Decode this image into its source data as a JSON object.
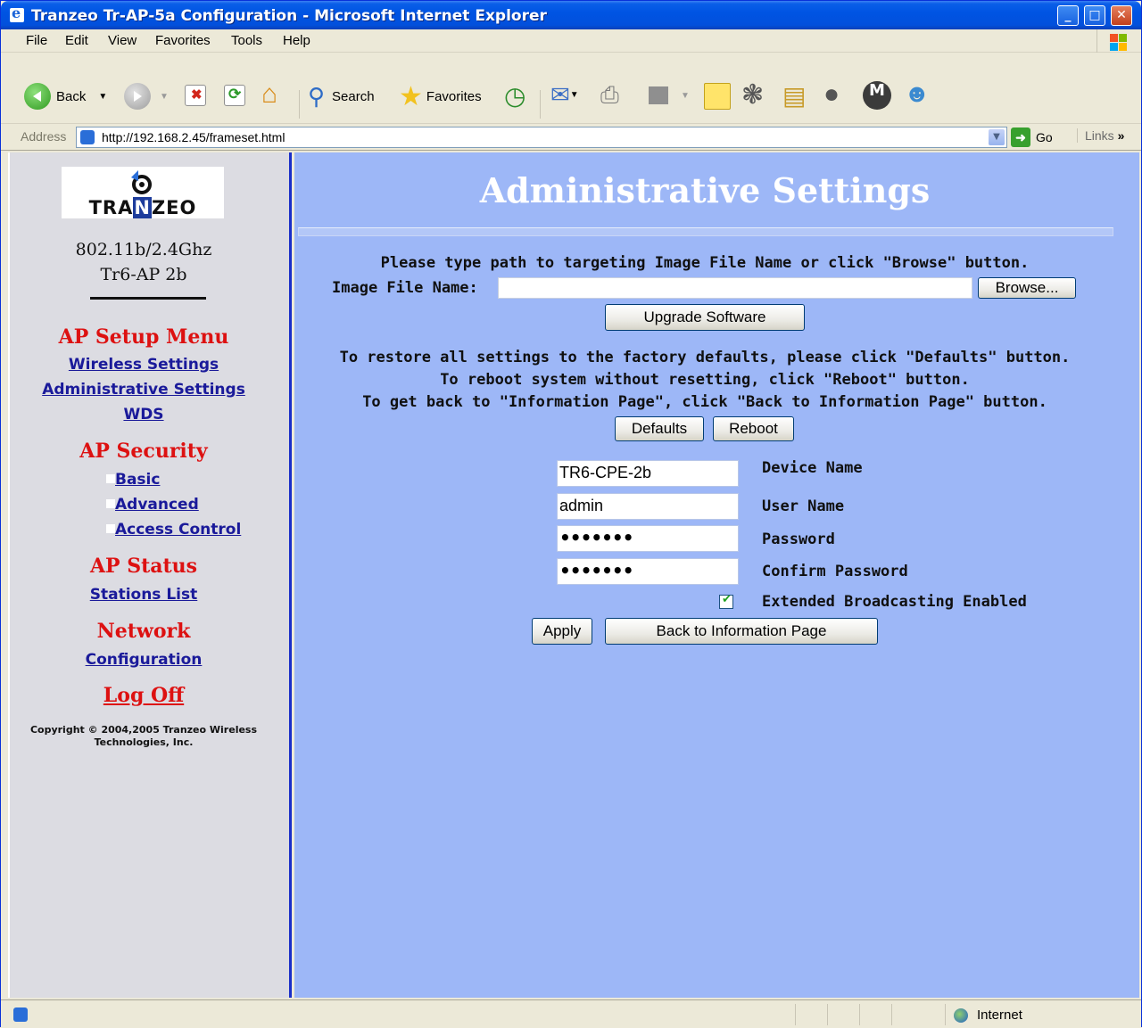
{
  "window": {
    "title": "Tranzeo Tr-AP-5a Configuration - Microsoft Internet Explorer"
  },
  "menubar": [
    "File",
    "Edit",
    "View",
    "Favorites",
    "Tools",
    "Help"
  ],
  "toolbar": {
    "back": "Back",
    "search": "Search",
    "favorites": "Favorites"
  },
  "addressbar": {
    "label": "Address",
    "url": "http://192.168.2.45/frameset.html",
    "go": "Go",
    "links": "Links"
  },
  "sidebar": {
    "logo_text_a": "TRA",
    "logo_text_n": "N",
    "logo_text_b": "ZEO",
    "model_line1": "802.11b/2.4Ghz",
    "model_line2": "Tr6-AP 2b",
    "sections": [
      {
        "heading": "AP Setup Menu",
        "links": [
          "Wireless Settings",
          "Administrative Settings",
          "WDS"
        ]
      },
      {
        "heading": "AP Security",
        "links": [
          "Basic",
          "Advanced",
          "Access Control"
        ]
      },
      {
        "heading": "AP Status",
        "links": [
          "Stations List"
        ]
      },
      {
        "heading": "Network",
        "links": [
          "Configuration"
        ]
      }
    ],
    "logoff": "Log Off",
    "copyright_line1": "Copyright © 2004,2005 Tranzeo Wireless",
    "copyright_line2": "Technologies, Inc."
  },
  "main": {
    "title": "Administrative Settings",
    "upgrade_instruction": "Please type path to targeting Image File Name or click \"Browse\" button.",
    "image_label": "Image File Name:",
    "image_value": "",
    "browse": "Browse...",
    "upgrade": "Upgrade Software",
    "restore_line1": "To restore all settings to the factory defaults, please click \"Defaults\" button.",
    "restore_line2": "To reboot system without resetting, click \"Reboot\" button.",
    "restore_line3": "To get back to \"Information Page\", click \"Back to Information Page\" button.",
    "defaults": "Defaults",
    "reboot": "Reboot",
    "device_name_label": "Device Name",
    "device_name_value": "TR6-CPE-2b",
    "user_name_label": "User Name",
    "user_name_value": "admin",
    "password_label": "Password",
    "password_value": "•••••••",
    "confirm_label": "Confirm Password",
    "confirm_value": "•••••••",
    "extended_label": "Extended Broadcasting Enabled",
    "extended_checked": true,
    "apply": "Apply",
    "back_info": "Back to Information Page"
  },
  "statusbar": {
    "zone": "Internet"
  }
}
